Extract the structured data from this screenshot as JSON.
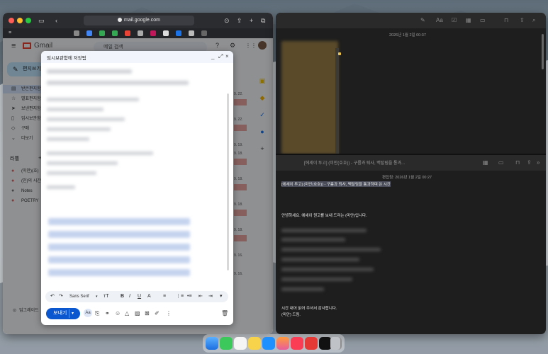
{
  "browser": {
    "url": "mail.google.com",
    "colors": {
      "close": "#ff5f57",
      "minimize": "#febc2e",
      "zoom": "#28c840"
    }
  },
  "gmail": {
    "logo": "Gmail",
    "search_placeholder": "메일 검색",
    "compose_label": "편지쓰기",
    "nav": [
      "받은편지함",
      "별표편지함",
      "보낸편지함",
      "임시보관함",
      "구매",
      "더보기"
    ],
    "labels_header": "라벨",
    "labels": [
      "(미안)(호)",
      "(인)의 시간",
      "Notes",
      "POETRY"
    ],
    "upgrade": "업그레이드",
    "dates": [
      "9. 22.",
      "9. 22.",
      "9. 19.",
      "9. 18.",
      "9. 18.",
      "9. 18.",
      "9. 18.",
      "9. 16.",
      "9. 16."
    ]
  },
  "compose": {
    "title": "임시보관함에 저장됨",
    "font": "Sans Serif",
    "send_label": "보내기",
    "aa_label": "Aa",
    "size_label": "тT"
  },
  "notes_top": {
    "date": "2026년 1월 2일 00:37"
  },
  "notes_bottom": {
    "title": "[에세이 투고] (미안(호호)) - 구름과 퇴사, 백탈림을 통과...",
    "date": "편집됨: 2026년 1월 2일 00:27",
    "heading": "[에세이 투고] (미안(호호)) - 구름과 퇴사, 백탈림을 통과하며 쓴 시간",
    "greeting": "안녕하세요. 에세이 원고를 보내 드리는 (미안)입니다.",
    "closing1": "시간 내어 읽어 주셔서 감사합니다.",
    "closing2": "(미안) 드림."
  }
}
